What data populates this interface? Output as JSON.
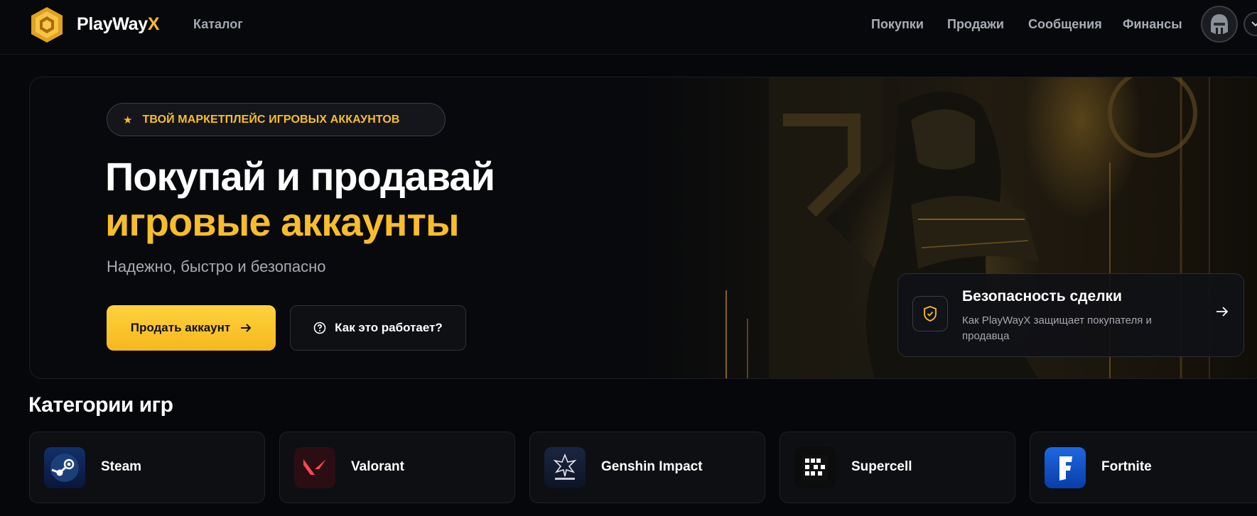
{
  "header": {
    "brand_main": "PlayWay",
    "brand_accent": "X",
    "catalog": "Каталог",
    "nav": [
      "Покупки",
      "Продажи",
      "Сообщения",
      "Финансы"
    ]
  },
  "hero": {
    "badge": "ТВОЙ МАРКЕТПЛЕЙС ИГРОВЫХ АККАУНТОВ",
    "title_line1": "Покупай и продавай",
    "title_line2": "игровые аккаунты",
    "subtitle": "Надежно, быстро и безопасно",
    "primary_button": "Продать аккаунт",
    "secondary_button": "Как это работает?",
    "safety": {
      "title": "Безопасность сделки",
      "description": "Как PlayWayX защищает покупателя и продавца"
    }
  },
  "categories": {
    "title": "Категории игр",
    "items": [
      "Steam",
      "Valorant",
      "Genshin Impact",
      "Supercell",
      "Fortnite"
    ]
  },
  "colors": {
    "accent": "#f7bd2a",
    "background": "#06070a",
    "card": "#0e0f13"
  }
}
